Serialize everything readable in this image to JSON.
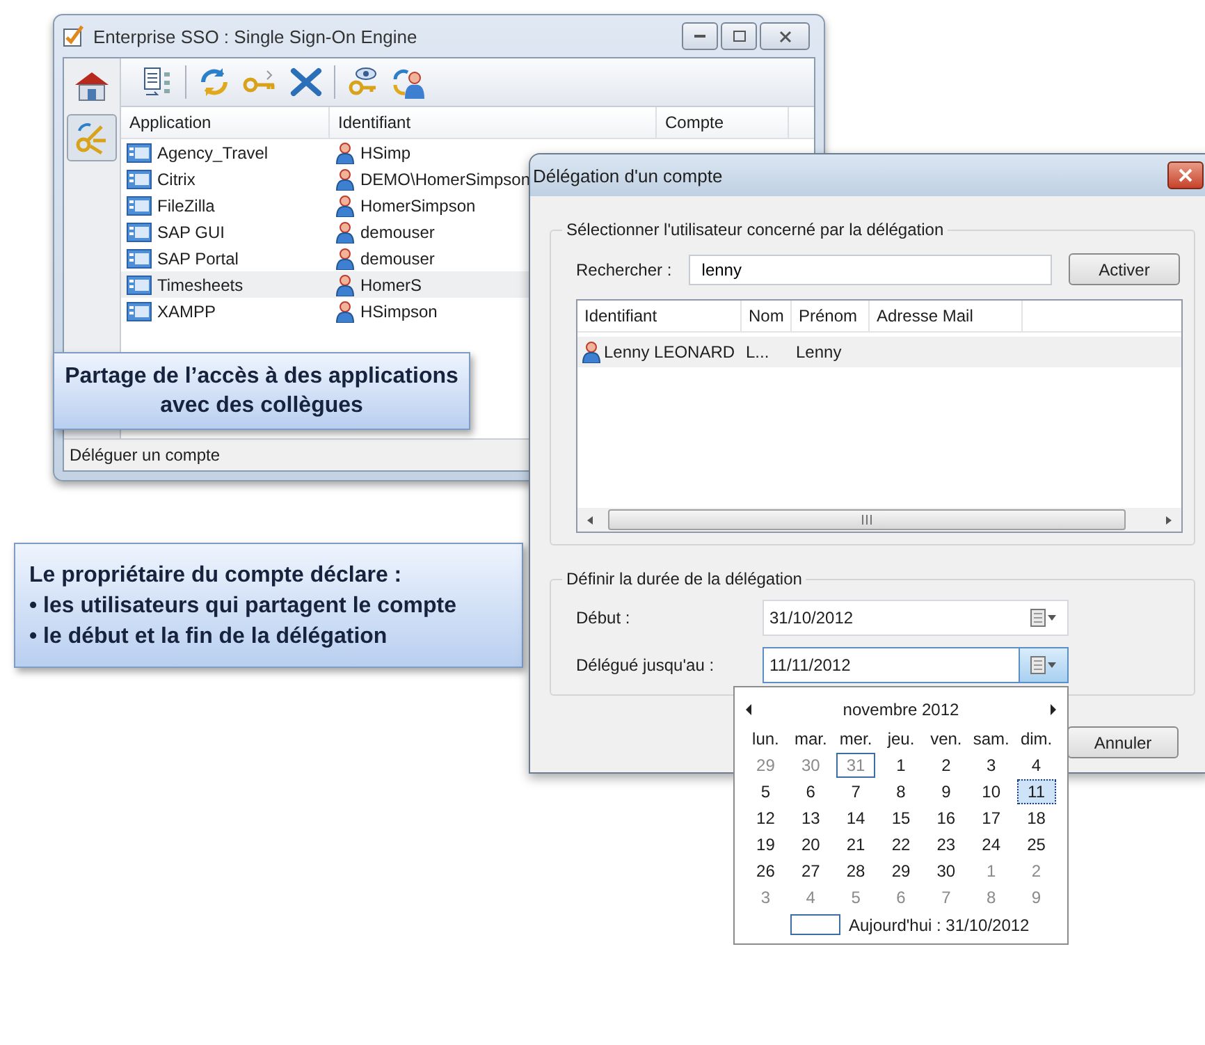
{
  "main_window": {
    "title": "Enterprise SSO : Single Sign-On Engine",
    "sidebar": [
      {
        "kind": "home",
        "selected": false
      },
      {
        "kind": "delegation",
        "selected": true
      }
    ],
    "columns": [
      "Application",
      "Identifiant",
      "Compte"
    ],
    "rows": [
      {
        "application": "Agency_Travel",
        "identifiant": "HSimp",
        "selected": false
      },
      {
        "application": "Citrix",
        "identifiant": "DEMO\\HomerSimpson",
        "selected": false
      },
      {
        "application": "FileZilla",
        "identifiant": "HomerSimpson",
        "selected": false
      },
      {
        "application": "SAP GUI",
        "identifiant": "demouser",
        "selected": false
      },
      {
        "application": "SAP Portal",
        "identifiant": "demouser",
        "selected": false
      },
      {
        "application": "Timesheets",
        "identifiant": "HomerS",
        "selected": true
      },
      {
        "application": "XAMPP",
        "identifiant": "HSimpson",
        "selected": false
      }
    ],
    "status_bar": "Déléguer un compte"
  },
  "callouts": [
    {
      "kind": "centered",
      "lines": [
        "Partage de l’accès à des applications",
        "avec des collègues"
      ]
    },
    {
      "kind": "list",
      "lines": [
        "Le propriétaire du compte déclare :",
        "• les utilisateurs qui partagent le compte",
        "• le début et la fin de la délégation"
      ]
    }
  ],
  "dialog": {
    "title": "Délégation d'un compte",
    "user_group": {
      "legend": "Sélectionner l'utilisateur concerné par la délégation",
      "search_label": "Rechercher :",
      "search_value": "lenny",
      "button": "Activer",
      "columns": [
        "Identifiant",
        "Nom",
        "Prénom",
        "Adresse Mail"
      ],
      "rows": [
        {
          "identifiant": "Lenny LEONARD",
          "nom": "L...",
          "prenom": "Lenny",
          "selected": true
        }
      ]
    },
    "duration_group": {
      "legend": "Définir la durée de la délégation",
      "start_label": "Début :",
      "start_value": "31/10/2012",
      "end_label": "Délégué jusqu'au :",
      "end_value": "11/11/2012",
      "end_open": true
    },
    "cancel_button": "Annuler"
  },
  "calendar": {
    "month": "novembre 2012",
    "weekdays": [
      "lun.",
      "mar.",
      "mer.",
      "jeu.",
      "ven.",
      "sam.",
      "dim."
    ],
    "days": [
      {
        "d": "29",
        "muted": true,
        "today": false,
        "selected": false
      },
      {
        "d": "30",
        "muted": true,
        "today": false,
        "selected": false
      },
      {
        "d": "31",
        "muted": true,
        "today": true,
        "selected": false
      },
      {
        "d": "1",
        "muted": false,
        "today": false,
        "selected": false
      },
      {
        "d": "2",
        "muted": false,
        "today": false,
        "selected": false
      },
      {
        "d": "3",
        "muted": false,
        "today": false,
        "selected": false
      },
      {
        "d": "4",
        "muted": false,
        "today": false,
        "selected": false
      },
      {
        "d": "5",
        "muted": false,
        "today": false,
        "selected": false
      },
      {
        "d": "6",
        "muted": false,
        "today": false,
        "selected": false
      },
      {
        "d": "7",
        "muted": false,
        "today": false,
        "selected": false
      },
      {
        "d": "8",
        "muted": false,
        "today": false,
        "selected": false
      },
      {
        "d": "9",
        "muted": false,
        "today": false,
        "selected": false
      },
      {
        "d": "10",
        "muted": false,
        "today": false,
        "selected": false
      },
      {
        "d": "11",
        "muted": false,
        "today": false,
        "selected": true
      },
      {
        "d": "12",
        "muted": false,
        "today": false,
        "selected": false
      },
      {
        "d": "13",
        "muted": false,
        "today": false,
        "selected": false
      },
      {
        "d": "14",
        "muted": false,
        "today": false,
        "selected": false
      },
      {
        "d": "15",
        "muted": false,
        "today": false,
        "selected": false
      },
      {
        "d": "16",
        "muted": false,
        "today": false,
        "selected": false
      },
      {
        "d": "17",
        "muted": false,
        "today": false,
        "selected": false
      },
      {
        "d": "18",
        "muted": false,
        "today": false,
        "selected": false
      },
      {
        "d": "19",
        "muted": false,
        "today": false,
        "selected": false
      },
      {
        "d": "20",
        "muted": false,
        "today": false,
        "selected": false
      },
      {
        "d": "21",
        "muted": false,
        "today": false,
        "selected": false
      },
      {
        "d": "22",
        "muted": false,
        "today": false,
        "selected": false
      },
      {
        "d": "23",
        "muted": false,
        "today": false,
        "selected": false
      },
      {
        "d": "24",
        "muted": false,
        "today": false,
        "selected": false
      },
      {
        "d": "25",
        "muted": false,
        "today": false,
        "selected": false
      },
      {
        "d": "26",
        "muted": false,
        "today": false,
        "selected": false
      },
      {
        "d": "27",
        "muted": false,
        "today": false,
        "selected": false
      },
      {
        "d": "28",
        "muted": false,
        "today": false,
        "selected": false
      },
      {
        "d": "29",
        "muted": false,
        "today": false,
        "selected": false
      },
      {
        "d": "30",
        "muted": false,
        "today": false,
        "selected": false
      },
      {
        "d": "1",
        "muted": true,
        "today": false,
        "selected": false
      },
      {
        "d": "2",
        "muted": true,
        "today": false,
        "selected": false
      },
      {
        "d": "3",
        "muted": true,
        "today": false,
        "selected": false
      },
      {
        "d": "4",
        "muted": true,
        "today": false,
        "selected": false
      },
      {
        "d": "5",
        "muted": true,
        "today": false,
        "selected": false
      },
      {
        "d": "6",
        "muted": true,
        "today": false,
        "selected": false
      },
      {
        "d": "7",
        "muted": true,
        "today": false,
        "selected": false
      },
      {
        "d": "8",
        "muted": true,
        "today": false,
        "selected": false
      },
      {
        "d": "9",
        "muted": true,
        "today": false,
        "selected": false
      }
    ],
    "today_label": "Aujourd'hui : 31/10/2012"
  }
}
